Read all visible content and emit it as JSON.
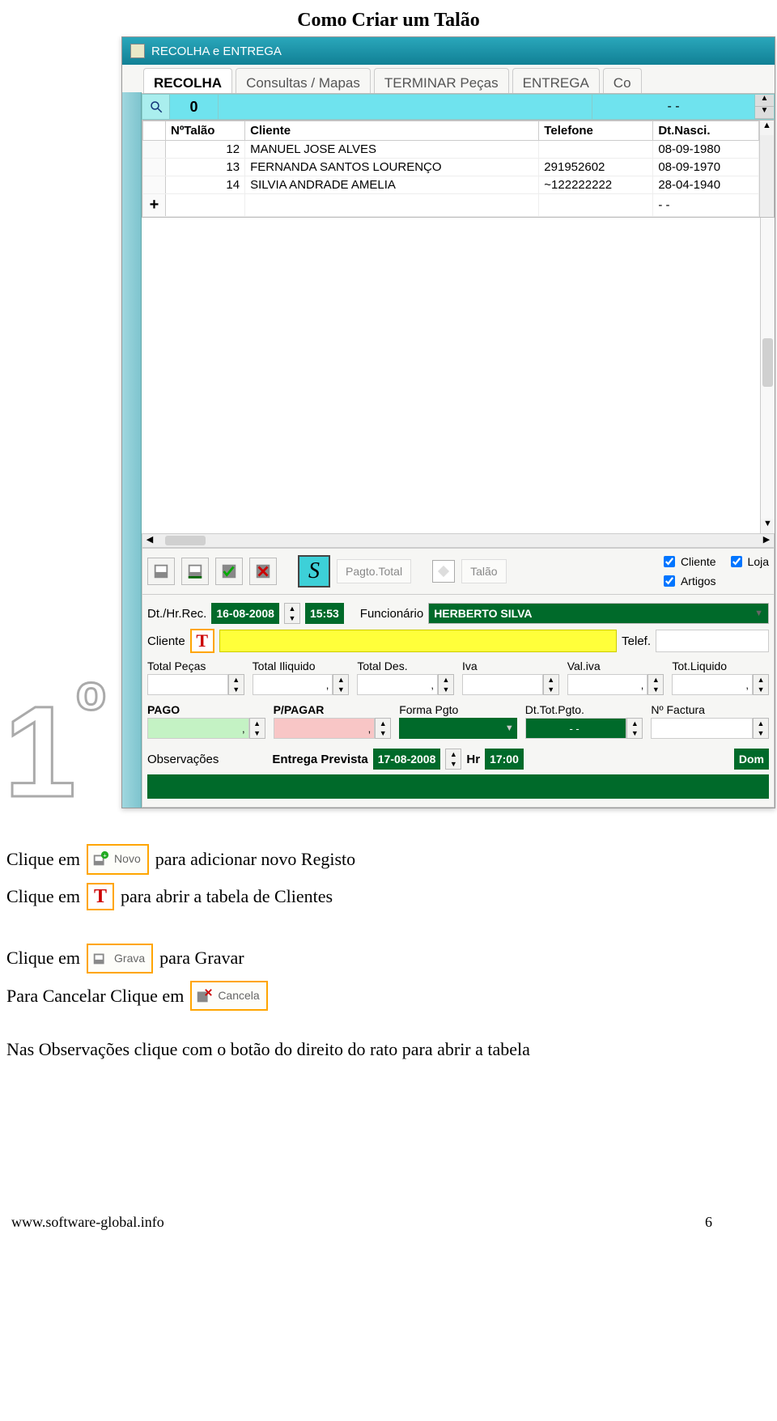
{
  "page": {
    "title": "Como Criar um Talão",
    "step_number": "1º",
    "footer_left": "www.software-global.info",
    "footer_right": "6"
  },
  "app": {
    "window_title": "RECOLHA e ENTREGA",
    "tabs": [
      "RECOLHA",
      "Consultas / Mapas",
      "TERMINAR Peças",
      "ENTREGA",
      "Co"
    ],
    "search_count": "0",
    "search_dash": "-   -"
  },
  "table": {
    "headers": [
      "NºTalão",
      "Cliente",
      "Telefone",
      "Dt.Nasci."
    ],
    "rows": [
      {
        "no": "12",
        "cliente": "MANUEL JOSE ALVES",
        "tel": "",
        "dt": "08-09-1980"
      },
      {
        "no": "13",
        "cliente": "FERNANDA SANTOS LOURENÇO",
        "tel": "291952602",
        "dt": "08-09-1970"
      },
      {
        "no": "14",
        "cliente": "SILVIA ANDRADE AMELIA",
        "tel": "~122222222",
        "dt": "28-04-1940"
      }
    ],
    "blank_dash": "-   -",
    "add_symbol": "+"
  },
  "toolbar": {
    "pagto_total": "Pagto.Total",
    "talao": "Talão",
    "checks": {
      "cliente": "Cliente",
      "artigos": "Artigos",
      "loja": "Loja"
    }
  },
  "form": {
    "dt_hr_rec_label": "Dt./Hr.Rec.",
    "date_rec": "16-08-2008",
    "time_rec": "15:53",
    "funcionario_label": "Funcionário",
    "funcionario_value": "HERBERTO SILVA",
    "cliente_label": "Cliente",
    "telef_label": "Telef.",
    "totals": {
      "total_pecas": "Total Peças",
      "total_iliquido": "Total Iliquido",
      "total_des": "Total Des.",
      "iva": "Iva",
      "val_iva": "Val.iva",
      "tot_liquido": "Tot.Liquido"
    },
    "comma": ",",
    "pay": {
      "pago": "PAGO",
      "ppagar": "P/PAGAR",
      "forma_pgto": "Forma Pgto",
      "dt_tot_pgto": "Dt.Tot.Pgto.",
      "no_factura": "Nº Factura",
      "dt_dash": "-   -"
    },
    "obs_label": "Observações",
    "entrega_prevista_label": "Entrega Prevista",
    "entrega_date": "17-08-2008",
    "hr_label": "Hr",
    "entrega_hr": "17:00",
    "dom": "Dom"
  },
  "instructions": {
    "click_em": "Clique em",
    "novo_text": "para adicionar novo Registo",
    "novo_btn": "Novo",
    "clientes_text": "para abrir a tabela de Clientes",
    "gravar_text": "para Gravar",
    "grava_btn": "Grava",
    "cancel_pre": "Para Cancelar Clique em",
    "cancela_btn": "Cancela",
    "obs_text": "Nas Observações clique com o botão do direito do rato para abrir a tabela"
  }
}
